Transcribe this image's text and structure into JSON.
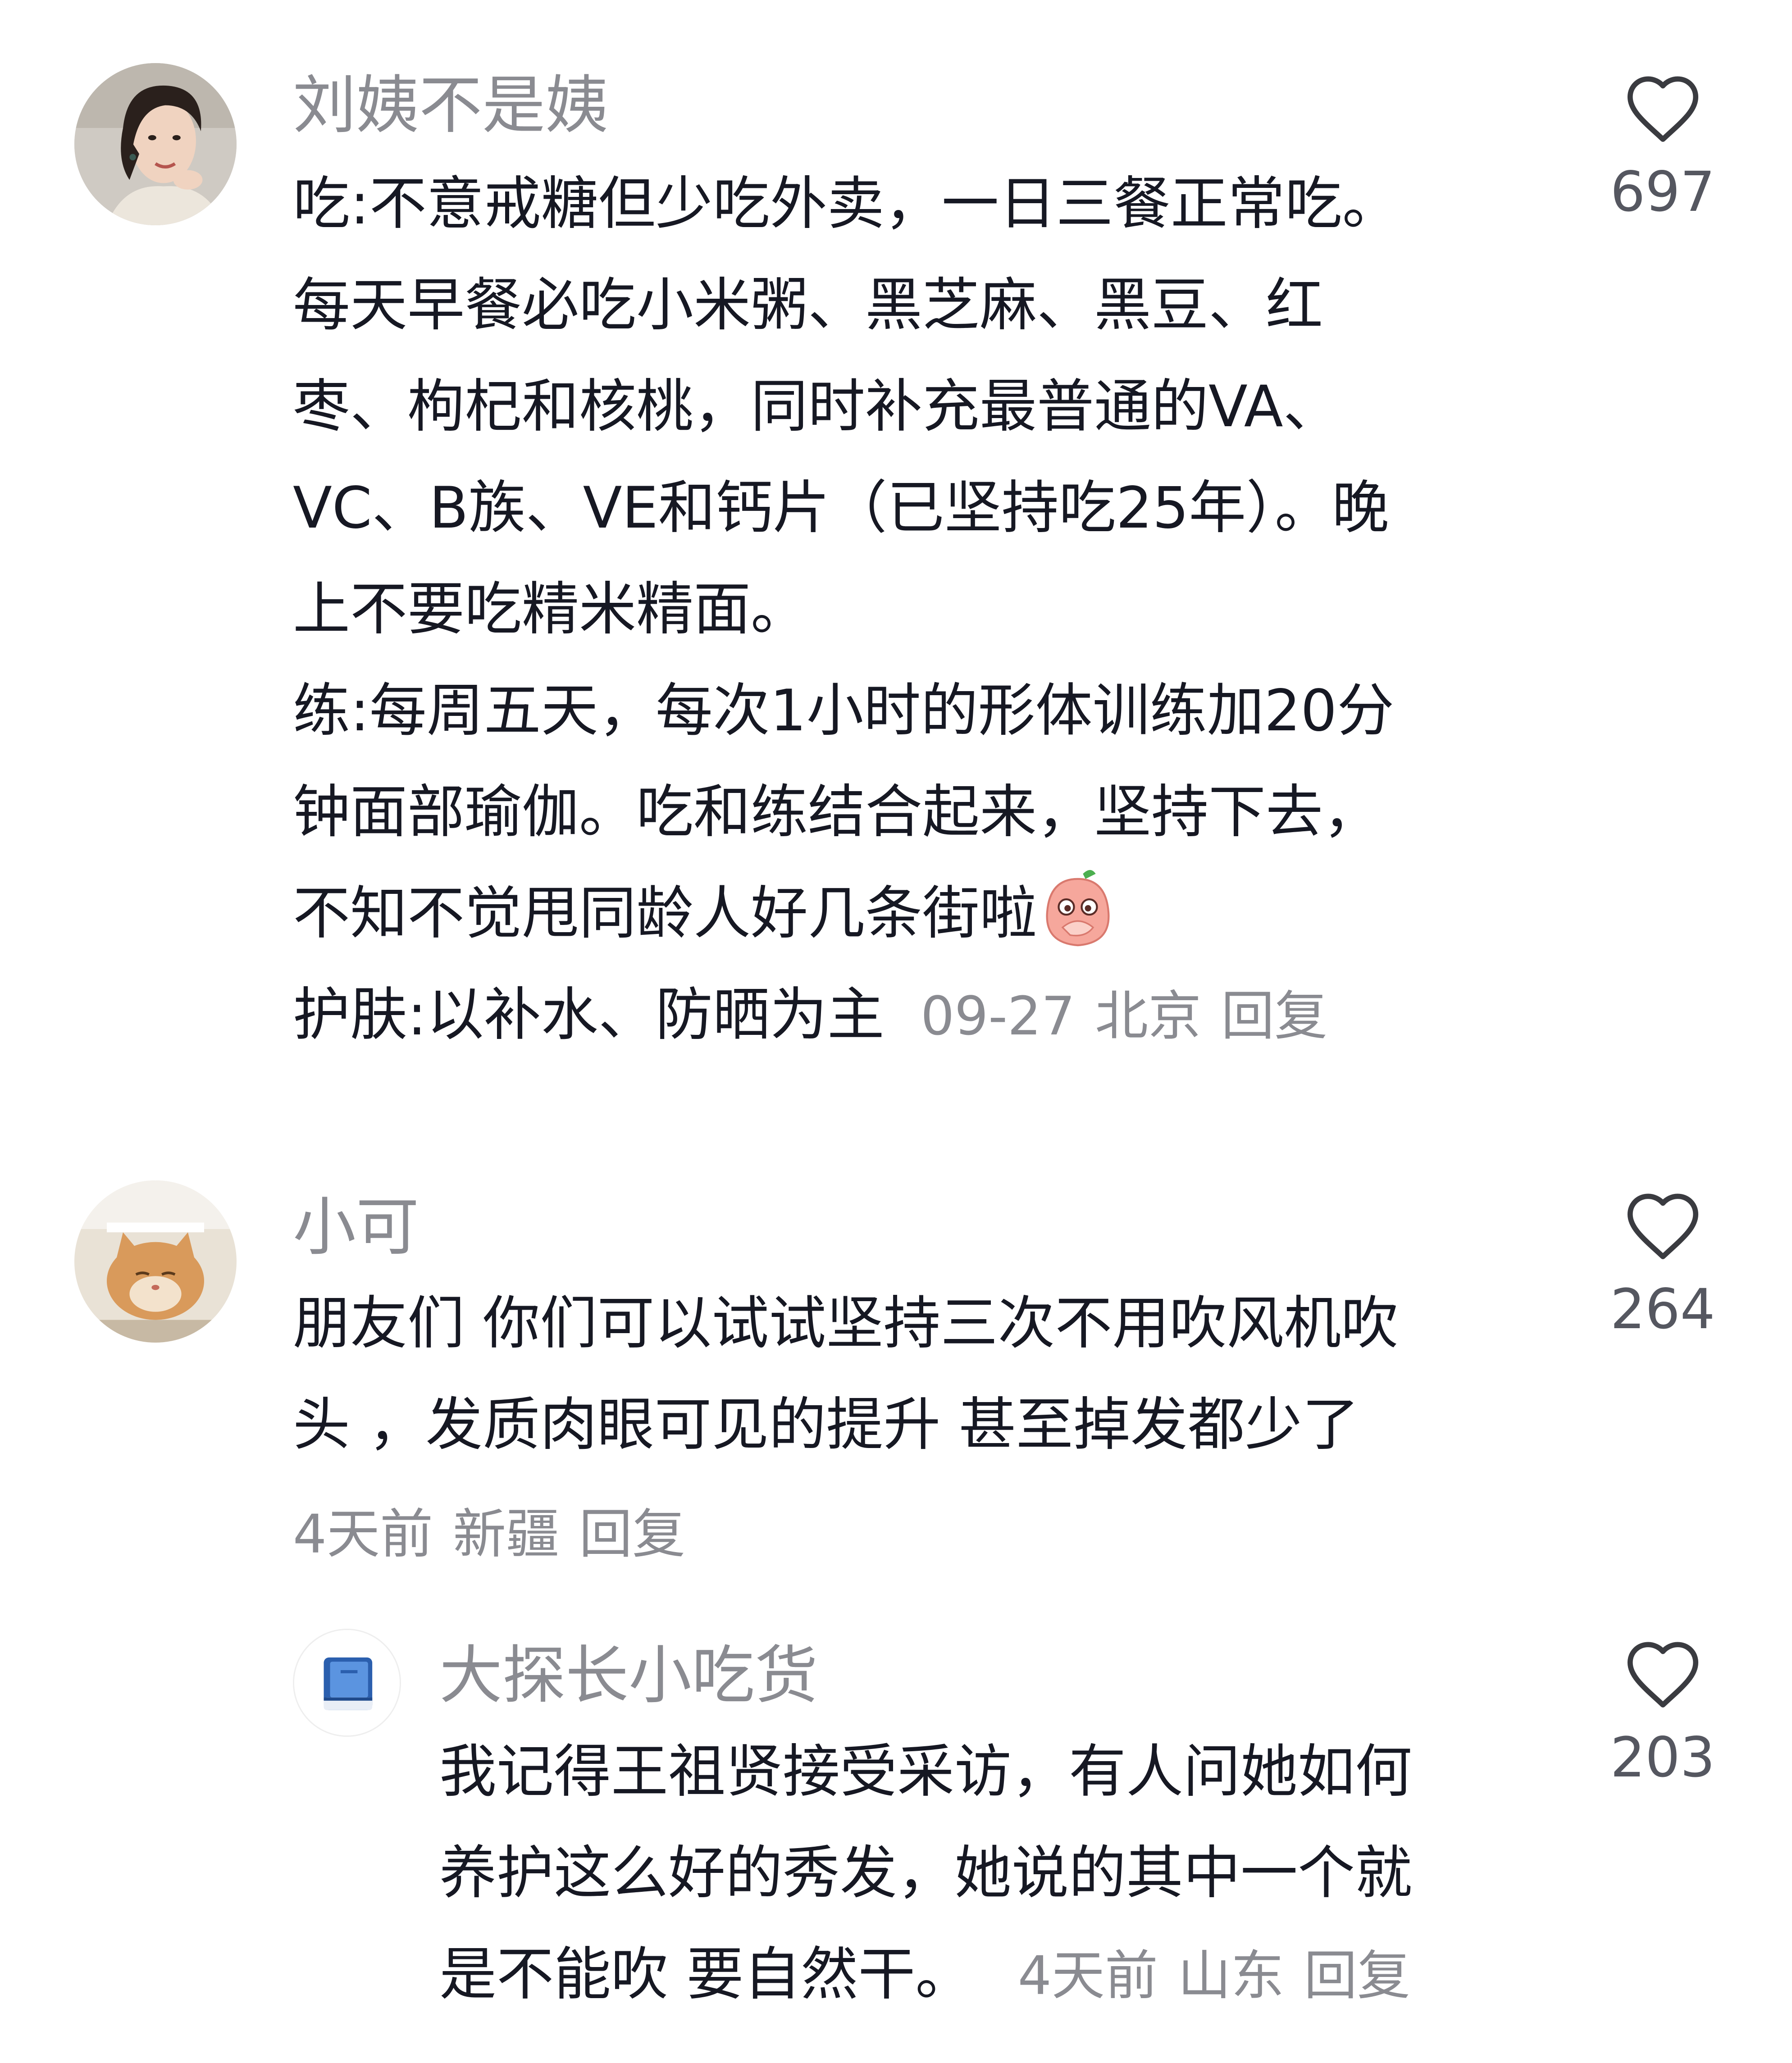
{
  "comments": [
    {
      "username": "刘姨不是姨",
      "lines": [
        "吃:不意戒糖但少吃外卖，一日三餐正常吃。",
        "每天早餐必吃小米粥、黑芝麻、黑豆、红",
        "枣、枸杞和核桃，同时补充最普通的VA、",
        "VC、B族、VE和钙片（已坚持吃25年）。晚",
        "上不要吃精米精面。",
        "练:每周五天，每次1小时的形体训练加20分",
        "钟面部瑜伽。吃和练结合起来，坚持下去，",
        "不知不觉甩同龄人好几条街啦"
      ],
      "last_line": "护肤:以补水、防晒为主",
      "emoji": "peach-covering-mouth",
      "date": "09-27",
      "location": "北京",
      "reply": "回复",
      "likes": "697"
    },
    {
      "username": "小可",
      "lines": [
        "朋友们 你们可以试试坚持三次不用吹风机吹",
        "头 ，发质肉眼可见的提升 甚至掉发都少了"
      ],
      "date": "4天前",
      "location": "新疆",
      "reply": "回复",
      "likes": "264"
    },
    {
      "username": "大探长小吃货",
      "lines": [
        "我记得王祖贤接受采访，有人问她如何",
        "养护这么好的秀发，她说的其中一个就"
      ],
      "last_line": "是不能吹 要自然干。",
      "date": "4天前",
      "location": "山东",
      "reply": "回复",
      "likes": "203"
    }
  ],
  "colors": {
    "text": "#161823",
    "muted": "#8a8b91",
    "like_count": "#555760"
  },
  "icons": {
    "like": "heart-outline-icon",
    "avatar_3": "blue-book-icon"
  }
}
